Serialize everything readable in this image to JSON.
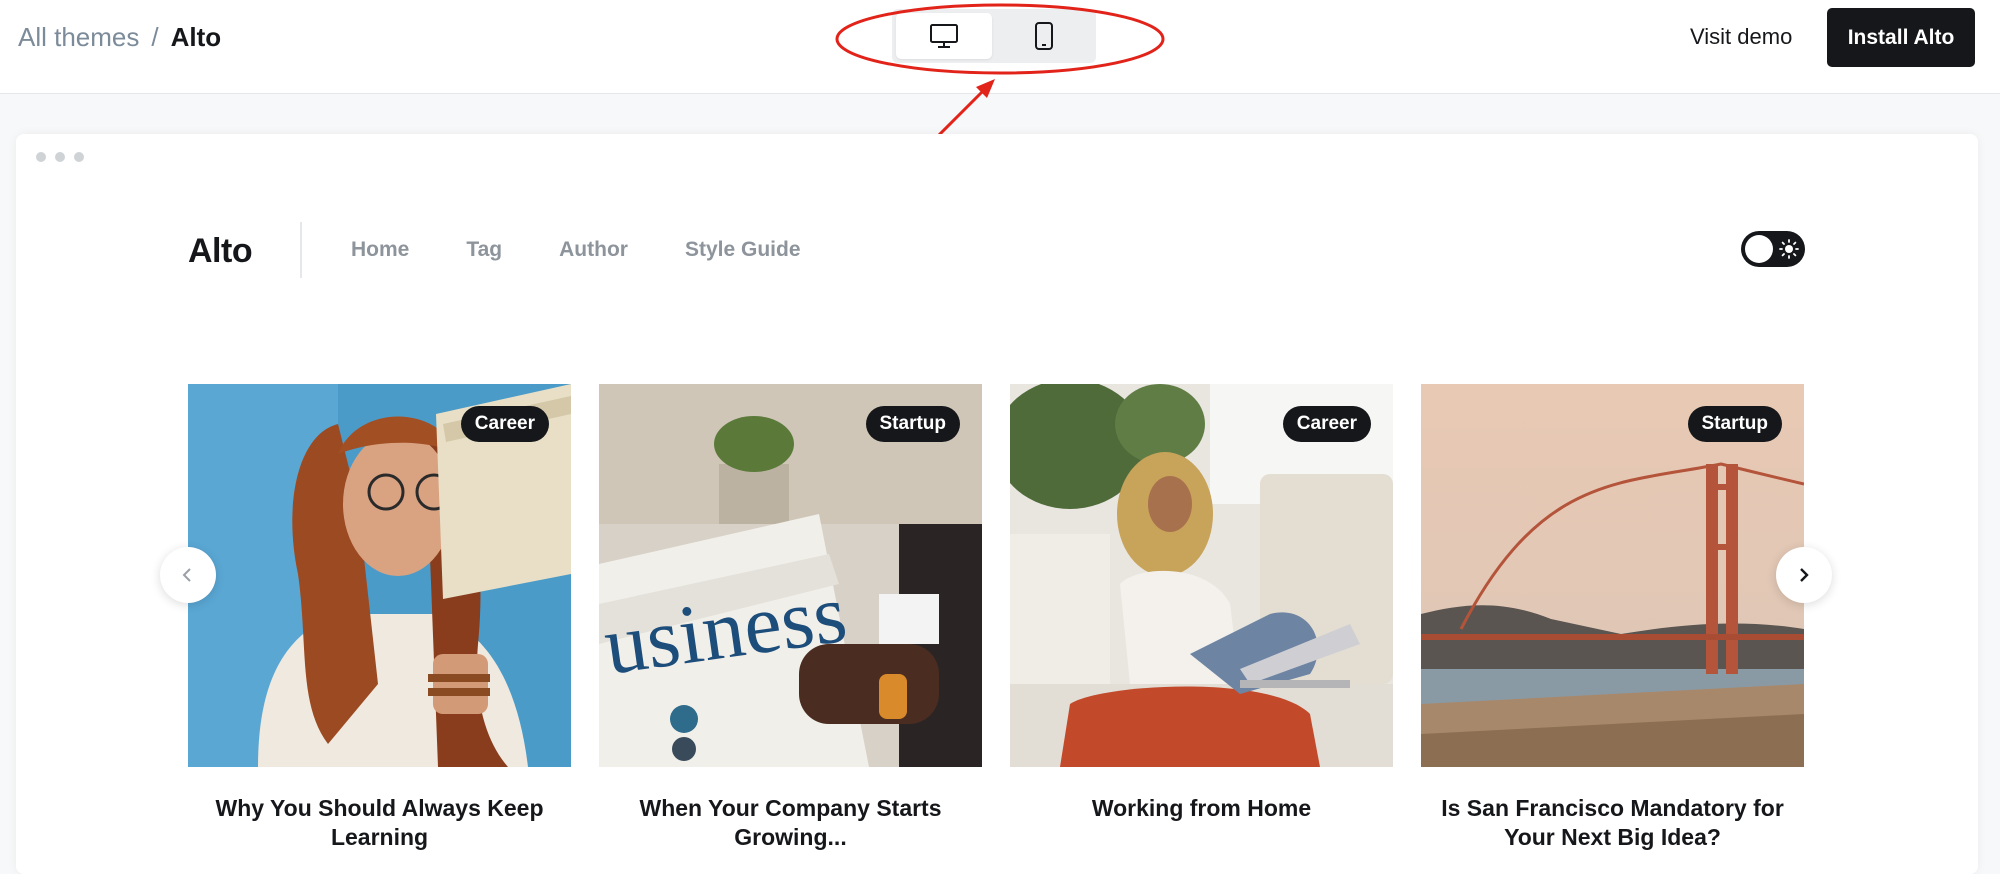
{
  "breadcrumb": {
    "all_themes": "All themes",
    "separator": "/",
    "current": "Alto"
  },
  "device_switch": {
    "options": [
      "desktop",
      "mobile"
    ],
    "selected": "desktop"
  },
  "header_actions": {
    "visit_demo": "Visit demo",
    "install": "Install Alto"
  },
  "annotation": {
    "color": "#e2231a"
  },
  "preview": {
    "site": {
      "logo": "Alto",
      "nav": [
        "Home",
        "Tag",
        "Author",
        "Style Guide"
      ]
    },
    "cards": [
      {
        "tag": "Career",
        "title": "Why You Should Always Keep Learning"
      },
      {
        "tag": "Startup",
        "title": "When Your Company Starts Growing..."
      },
      {
        "tag": "Career",
        "title": "Working from Home"
      },
      {
        "tag": "Startup",
        "title": "Is San Francisco Mandatory for Your Next Big Idea?"
      }
    ]
  },
  "colors": {
    "brand_dark": "#15171a",
    "muted_text": "#7c8b9a",
    "nav_text": "#8d949b"
  }
}
